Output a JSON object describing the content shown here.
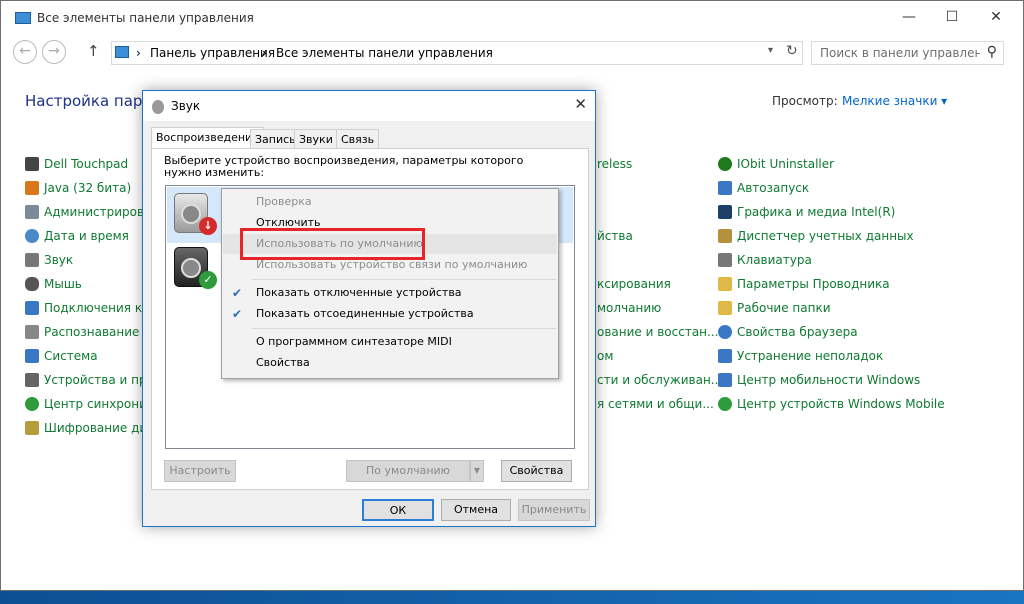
{
  "window": {
    "title": "Все элементы панели управления",
    "minimize": "—",
    "maximize": "☐",
    "close": "✕"
  },
  "addressbar": {
    "back": "←",
    "forward": "→",
    "up": "↑",
    "sep": "›",
    "crumbs": [
      "Панель управления",
      "Все элементы панели управления"
    ],
    "dropdown": "▾",
    "refresh": "↻",
    "search_placeholder": "Поиск в панели управления",
    "search_icon": "⚲"
  },
  "header": {
    "title": "Настройка парам",
    "view_label": "Просмотр:",
    "view_value": "Мелкие значки ▾"
  },
  "items_left": [
    {
      "label": "Dell Touchpad",
      "icon": "touchpad-icon",
      "color": "#444444"
    },
    {
      "label": "Java (32 бита)",
      "icon": "java-icon",
      "color": "#d9761c"
    },
    {
      "label": "Администрирован",
      "icon": "admin-tools-icon",
      "color": "#7a8a9a"
    },
    {
      "label": "Дата и время",
      "icon": "clock-icon",
      "color": "#4a88c8"
    },
    {
      "label": "Звук",
      "icon": "speaker-icon",
      "color": "#777777"
    },
    {
      "label": "Мышь",
      "icon": "mouse-icon",
      "color": "#555555"
    },
    {
      "label": "Подключения к уд",
      "icon": "remote-icon",
      "color": "#3a77c4"
    },
    {
      "label": "Распознавание реч",
      "icon": "microphone-icon",
      "color": "#888888"
    },
    {
      "label": "Система",
      "icon": "system-icon",
      "color": "#3a77c4"
    },
    {
      "label": "Устройства и прин",
      "icon": "printer-icon",
      "color": "#666666"
    },
    {
      "label": "Центр синхронизац",
      "icon": "sync-icon",
      "color": "#2e9c3c"
    },
    {
      "label": "Шифрование диска",
      "icon": "bitlocker-icon",
      "color": "#b49b3c"
    }
  ],
  "items_mid": [
    {
      "label": "reless"
    },
    {
      "label": "йства"
    },
    {
      "label": "ксирования"
    },
    {
      "label": "молчанию"
    },
    {
      "label": "ование и восстан..."
    },
    {
      "label": "ом"
    },
    {
      "label": "сти и обслуживан..."
    },
    {
      "label": "я сетями и общи..."
    }
  ],
  "items_right": [
    {
      "label": "IObit Uninstaller",
      "icon": "iobit-icon",
      "color": "#1d7a1d"
    },
    {
      "label": "Автозапуск",
      "icon": "autoplay-icon",
      "color": "#3a77c4"
    },
    {
      "label": "Графика и медиа Intel(R)",
      "icon": "intel-graphics-icon",
      "color": "#1f3f6b"
    },
    {
      "label": "Диспетчер учетных данных",
      "icon": "credentials-icon",
      "color": "#b4913c"
    },
    {
      "label": "Клавиатура",
      "icon": "keyboard-icon",
      "color": "#777777"
    },
    {
      "label": "Параметры Проводника",
      "icon": "folder-options-icon",
      "color": "#e0b848"
    },
    {
      "label": "Рабочие папки",
      "icon": "work-folders-icon",
      "color": "#e0b848"
    },
    {
      "label": "Свойства браузера",
      "icon": "browser-icon",
      "color": "#3a77c4"
    },
    {
      "label": "Устранение неполадок",
      "icon": "troubleshoot-icon",
      "color": "#3a77c4"
    },
    {
      "label": "Центр мобильности Windows",
      "icon": "mobility-icon",
      "color": "#3a77c4"
    },
    {
      "label": "Центр устройств Windows Mobile",
      "icon": "windows-mobile-icon",
      "color": "#2e9c3c"
    }
  ],
  "dialog": {
    "title": "Звук",
    "close": "✕",
    "tabs": [
      "Воспроизведение",
      "Запись",
      "Звуки",
      "Связь"
    ],
    "description": "Выберите устройство воспроизведения, параметры которого нужно изменить:",
    "buttons": {
      "configure": "Настроить",
      "set_default": "По умолчанию",
      "default_arrow": "▼",
      "properties": "Свойства",
      "ok": "ОК",
      "cancel": "Отмена",
      "apply": "Применить"
    },
    "badges": {
      "disabled": "↓",
      "default": "✓"
    }
  },
  "context_menu": {
    "items": [
      {
        "label": "Проверка",
        "disabled": true,
        "checked": false
      },
      {
        "label": "Отключить",
        "disabled": false,
        "checked": false
      },
      {
        "label": "Использовать по умолчанию",
        "disabled": true,
        "checked": false
      },
      {
        "label": "Использовать устройство связи по умолчанию",
        "disabled": true,
        "checked": false
      },
      {
        "label": "Показать отключенные устройства",
        "disabled": false,
        "checked": true
      },
      {
        "label": "Показать отсоединенные устройства",
        "disabled": false,
        "checked": true
      },
      {
        "label": "О программном синтезаторе MIDI",
        "disabled": false,
        "checked": false
      },
      {
        "label": "Свойства",
        "disabled": false,
        "checked": false
      }
    ],
    "check_glyph": "✔",
    "highlight_color": "#e8242a"
  }
}
